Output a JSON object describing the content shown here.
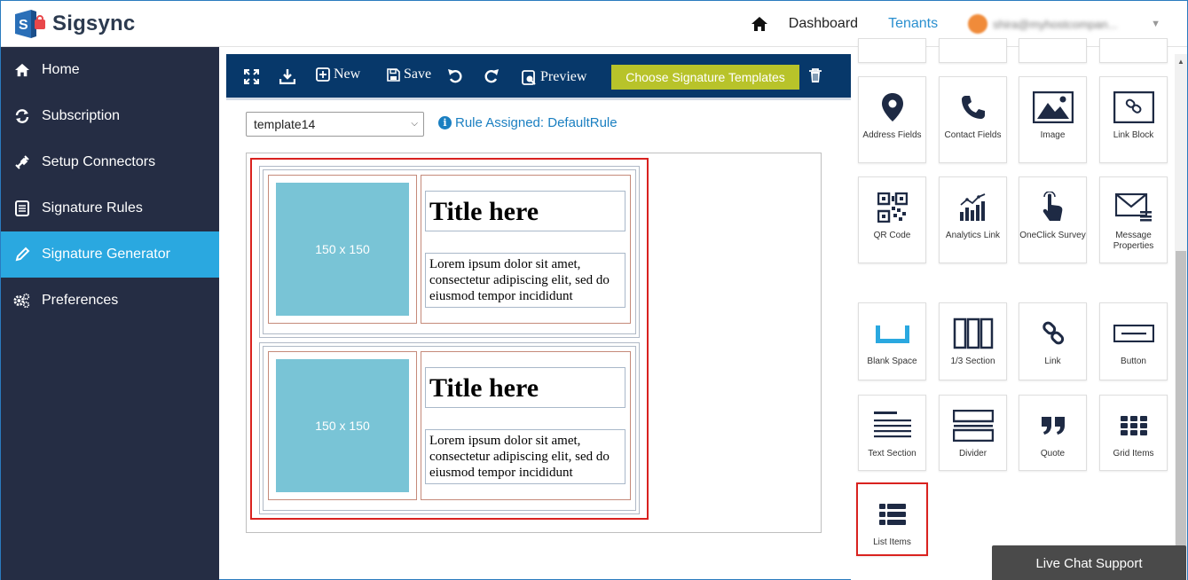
{
  "app": {
    "name": "Sigsync"
  },
  "topnav": {
    "dashboard": "Dashboard",
    "tenants": "Tenants",
    "user_email": "shira@myhostcompan..."
  },
  "sidebar": {
    "items": [
      {
        "label": "Home",
        "icon": "home-icon"
      },
      {
        "label": "Subscription",
        "icon": "sync-icon"
      },
      {
        "label": "Setup Connectors",
        "icon": "plug-icon"
      },
      {
        "label": "Signature Rules",
        "icon": "list-icon"
      },
      {
        "label": "Signature Generator",
        "icon": "pencil-icon",
        "active": true
      },
      {
        "label": "Preferences",
        "icon": "gears-icon"
      }
    ]
  },
  "toolbar": {
    "new": "New",
    "save": "Save",
    "preview": "Preview",
    "choose": "Choose Signature Templates"
  },
  "template_select": {
    "value": "template14"
  },
  "rule": {
    "text": "Rule Assigned: DefaultRule"
  },
  "blocks": [
    {
      "placeholder": "150 x 150",
      "title": "Title here",
      "body": "Lorem ipsum dolor sit amet, consectetur adipiscing elit, sed do eiusmod tempor incididunt"
    },
    {
      "placeholder": "150 x 150",
      "title": "Title here",
      "body": "Lorem ipsum dolor sit amet, consectetur adipiscing elit, sed do eiusmod tempor incididunt"
    }
  ],
  "tiles": [
    {
      "label": "Address Fields",
      "icon": "map-pin-icon"
    },
    {
      "label": "Contact Fields",
      "icon": "phone-icon"
    },
    {
      "label": "Image",
      "icon": "image-icon"
    },
    {
      "label": "Link Block",
      "icon": "link-block-icon"
    },
    {
      "label": "QR Code",
      "icon": "qr-code-icon"
    },
    {
      "label": "Analytics Link",
      "icon": "analytics-icon"
    },
    {
      "label": "OneClick Survey",
      "icon": "tap-icon"
    },
    {
      "label": "Message Properties",
      "icon": "envelope-icon"
    },
    {
      "label": "Blank Space",
      "icon": "blank-space-icon"
    },
    {
      "label": "1/3 Section",
      "icon": "columns-icon"
    },
    {
      "label": "Link",
      "icon": "link-icon"
    },
    {
      "label": "Button",
      "icon": "button-icon"
    },
    {
      "label": "Text Section",
      "icon": "text-lines-icon"
    },
    {
      "label": "Divider",
      "icon": "divider-icon"
    },
    {
      "label": "Quote",
      "icon": "quote-icon"
    },
    {
      "label": "Grid Items",
      "icon": "grid-icon"
    },
    {
      "label": "List Items",
      "icon": "list-items-icon"
    }
  ],
  "chat": {
    "label": "Live Chat Support"
  },
  "colors": {
    "sidebar": "#252d44",
    "active": "#2aa8e0",
    "toolbar": "#07386a",
    "choose_button": "#b8c32a",
    "highlight": "#d9221f",
    "placeholder": "#79c4d6"
  }
}
